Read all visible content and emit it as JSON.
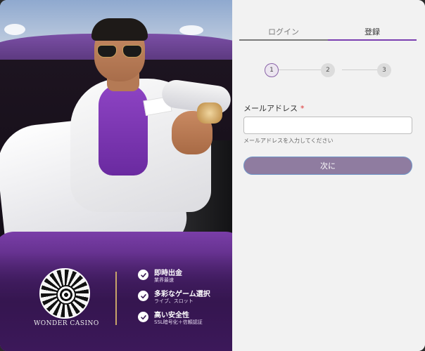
{
  "promo": {
    "logo_text": "WONDER CASINO",
    "features": [
      {
        "title": "即時出金",
        "subtitle": "業界最速"
      },
      {
        "title": "多彩なゲーム選択",
        "subtitle": "ライブ、スロット"
      },
      {
        "title": "高い安全性",
        "subtitle": "SSL暗号化＋信頼認証"
      }
    ]
  },
  "form": {
    "tabs": [
      {
        "label": "ログイン",
        "active": false
      },
      {
        "label": "登録",
        "active": true
      }
    ],
    "steps": [
      "1",
      "2",
      "3"
    ],
    "current_step": 1,
    "email": {
      "label": "メールアドレス",
      "required_mark": "*",
      "value": "",
      "hint": "メールアドレスを入力してください"
    },
    "next_label": "次に"
  },
  "colors": {
    "accent": "#7b3fb0",
    "button": "#8f7ca0",
    "required": "#dd3333"
  }
}
